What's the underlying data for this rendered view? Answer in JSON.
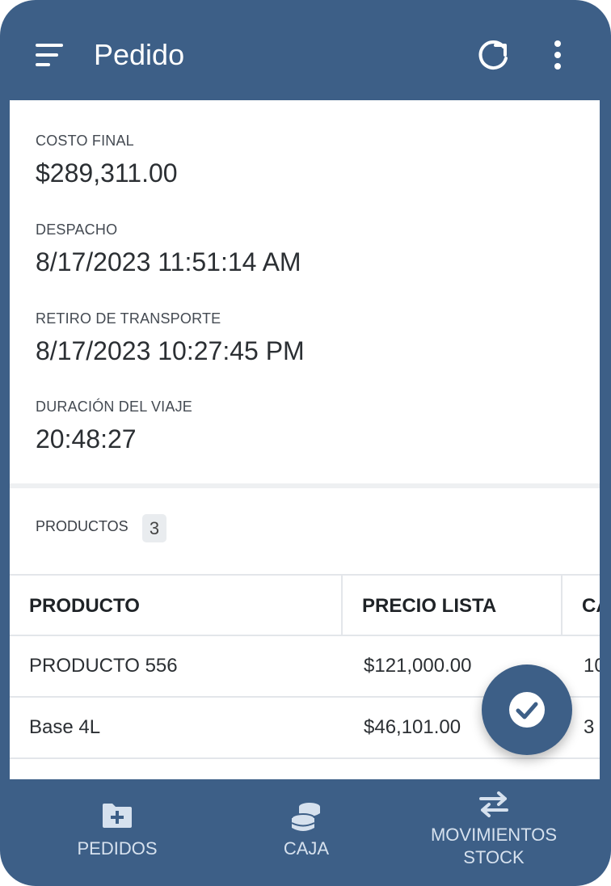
{
  "app_bar": {
    "title": "Pedido",
    "icons": {
      "menu": "menu-icon",
      "refresh": "refresh-icon",
      "more": "more-vert-icon"
    }
  },
  "details": [
    {
      "label": "COSTO FINAL",
      "value": "$289,311.00"
    },
    {
      "label": "DESPACHO",
      "value": "8/17/2023 11:51:14 AM"
    },
    {
      "label": "RETIRO DE TRANSPORTE",
      "value": "8/17/2023 10:27:45 PM"
    },
    {
      "label": "DURACIÓN DEL VIAJE",
      "value": "20:48:27"
    }
  ],
  "products": {
    "label": "PRODUCTOS",
    "count": "3",
    "columns": [
      "PRODUCTO",
      "PRECIO LISTA",
      "CA"
    ],
    "rows": [
      [
        "PRODUCTO 556",
        "$121,000.00",
        "10"
      ],
      [
        "Base 4L",
        "$46,101.00",
        "3"
      ]
    ]
  },
  "fab": {
    "icon": "check-circle-icon"
  },
  "bottom_nav": [
    {
      "label": "PEDIDOS",
      "icon": "folder-add-icon"
    },
    {
      "label": "CAJA",
      "icon": "coins-icon"
    },
    {
      "label_line1": "MOVIMIENTOS",
      "label_line2": "STOCK",
      "icon": "swap-arrows-icon"
    }
  ],
  "colors": {
    "primary": "#3d5f87",
    "surface": "#ffffff",
    "nav_text": "#d6e1ee"
  }
}
